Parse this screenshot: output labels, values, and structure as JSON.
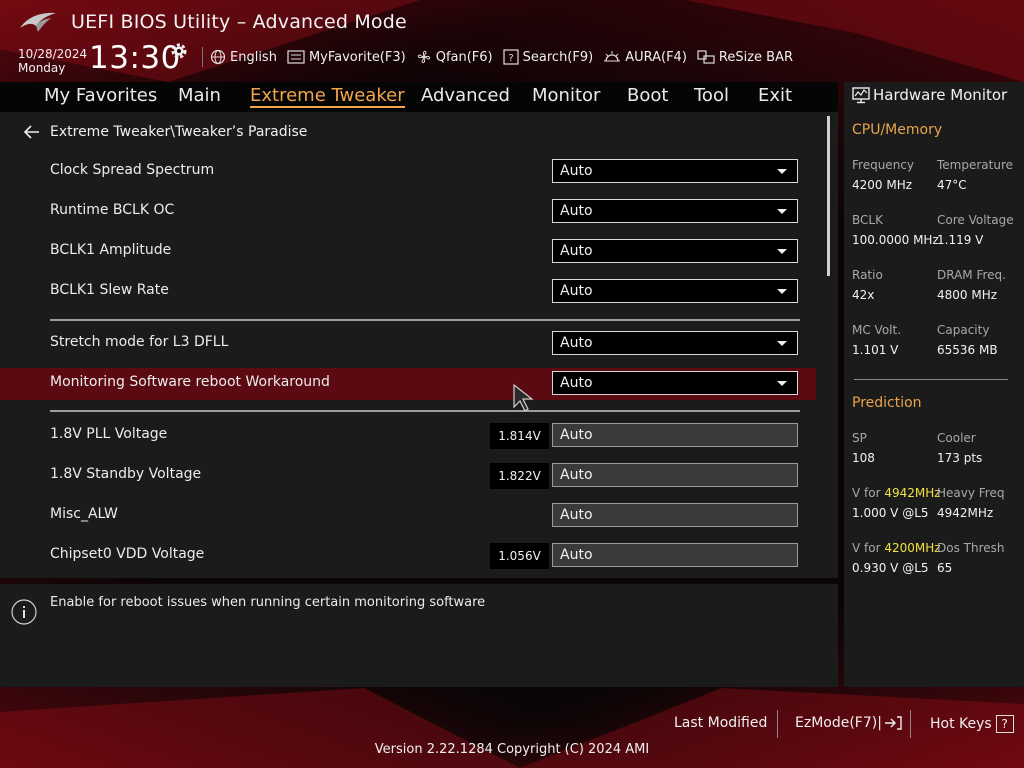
{
  "app": {
    "title": "UEFI BIOS Utility – Advanced Mode"
  },
  "clock": {
    "date": "10/28/2024",
    "day": "Monday",
    "time": "13:30"
  },
  "toolbar": {
    "language": "English",
    "myfavorite": "MyFavorite(F3)",
    "qfan": "Qfan(F6)",
    "search": "Search(F9)",
    "aura": "AURA(F4)",
    "resizebar": "ReSize BAR"
  },
  "tabs": [
    "My Favorites",
    "Main",
    "Extreme Tweaker",
    "Advanced",
    "Monitor",
    "Boot",
    "Tool",
    "Exit"
  ],
  "active_tab": "Extreme Tweaker",
  "breadcrumb": "Extreme Tweaker\\Tweaker’s Paradise",
  "settings": [
    {
      "label": "Clock Spread Spectrum",
      "value": "Auto"
    },
    {
      "label": "Runtime BCLK OC",
      "value": "Auto"
    },
    {
      "label": "BCLK1 Amplitude",
      "value": "Auto"
    },
    {
      "label": "BCLK1 Slew Rate",
      "value": "Auto"
    },
    {
      "label": "Stretch mode for L3 DFLL",
      "value": "Auto"
    },
    {
      "label": "Monitoring Software reboot Workaround",
      "value": "Auto"
    },
    {
      "label": "1.8V PLL Voltage",
      "reading": "1.814V",
      "value": "Auto"
    },
    {
      "label": "1.8V Standby Voltage",
      "reading": "1.822V",
      "value": "Auto"
    },
    {
      "label": "Misc_ALW",
      "value": "Auto"
    },
    {
      "label": "Chipset0 VDD Voltage",
      "reading": "1.056V",
      "value": "Auto"
    }
  ],
  "help_text": "Enable for reboot issues when running certain monitoring software",
  "hardware_monitor": {
    "title": "Hardware Monitor",
    "cpu_memory": {
      "title": "CPU/Memory",
      "frequency_label": "Frequency",
      "frequency": "4200 MHz",
      "temperature_label": "Temperature",
      "temperature": "47°C",
      "bclk_label": "BCLK",
      "bclk": "100.0000 MHz",
      "core_voltage_label": "Core Voltage",
      "core_voltage": "1.119 V",
      "ratio_label": "Ratio",
      "ratio": "42x",
      "dram_label": "DRAM Freq.",
      "dram": "4800 MHz",
      "mc_volt_label": "MC Volt.",
      "mc_volt": "1.101 V",
      "capacity_label": "Capacity",
      "capacity": "65536 MB"
    },
    "prediction": {
      "title": "Prediction",
      "sp_label": "SP",
      "sp": "108",
      "cooler_label": "Cooler",
      "cooler": "173 pts",
      "v1_label_prefix": "V for ",
      "v1_freq": "4942MHz",
      "v1": "1.000 V @L5",
      "heavy_label": "Heavy Freq",
      "heavy": "4942MHz",
      "v2_label_prefix": "V for ",
      "v2_freq": "4200MHz",
      "v2": "0.930 V @L5",
      "dos_label": "Dos Thresh",
      "dos": "65"
    }
  },
  "footer": {
    "last_modified": "Last Modified",
    "ezmode": "EzMode(F7)|",
    "hotkeys": "Hot Keys",
    "hotkeys_key": "?",
    "version": "Version 2.22.1284 Copyright (C) 2024 AMI"
  },
  "colors": {
    "accent": "#f2a54a",
    "selected_row": "#5a0a10",
    "highlight": "#f0e040"
  }
}
